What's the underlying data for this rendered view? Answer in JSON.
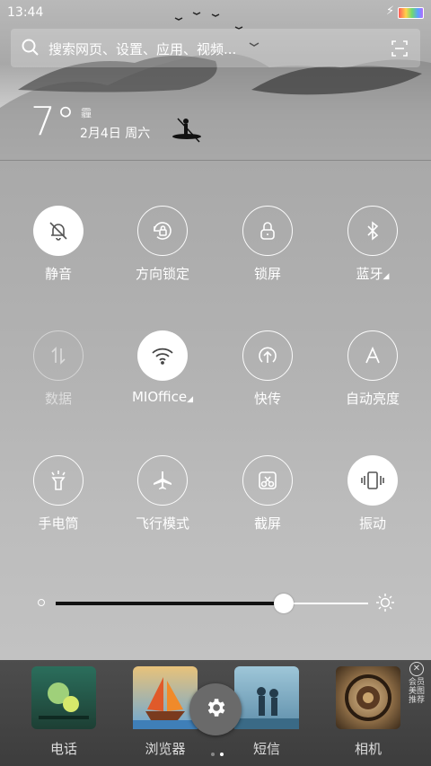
{
  "status_bar": {
    "time": "13:44",
    "charging_icon": "lightning-icon",
    "battery_icon": "battery-icon"
  },
  "search": {
    "placeholder": "搜索网页、设置、应用、视频...",
    "icon": "search-icon",
    "scan_icon": "scan-icon"
  },
  "weather": {
    "temperature": "7°",
    "condition": "霾",
    "date": "2月4日 周六"
  },
  "toggles": [
    {
      "label": "静音",
      "icon": "bell-off-icon",
      "state": "on"
    },
    {
      "label": "方向锁定",
      "icon": "rotation-lock-icon",
      "state": "off"
    },
    {
      "label": "锁屏",
      "icon": "lock-icon",
      "state": "off"
    },
    {
      "label": "蓝牙",
      "icon": "bluetooth-icon",
      "state": "off",
      "has_menu": true
    },
    {
      "label": "数据",
      "icon": "mobile-data-icon",
      "state": "disabled"
    },
    {
      "label": "MIOffice",
      "icon": "wifi-icon",
      "state": "on",
      "has_menu": true
    },
    {
      "label": "快传",
      "icon": "share-upload-icon",
      "state": "off"
    },
    {
      "label": "自动亮度",
      "icon": "auto-brightness-icon",
      "state": "off"
    },
    {
      "label": "手电筒",
      "icon": "flashlight-icon",
      "state": "off"
    },
    {
      "label": "飞行模式",
      "icon": "airplane-icon",
      "state": "off"
    },
    {
      "label": "截屏",
      "icon": "screenshot-icon",
      "state": "off"
    },
    {
      "label": "振动",
      "icon": "vibrate-icon",
      "state": "on"
    }
  ],
  "brightness": {
    "level": 0.73,
    "min_icon": "brightness-low-icon",
    "max_icon": "brightness-high-icon"
  },
  "dock": {
    "apps": [
      {
        "label": "电话",
        "icon": "phone-app-icon"
      },
      {
        "label": "浏览器",
        "icon": "browser-app-icon"
      },
      {
        "label": "短信",
        "icon": "messages-app-icon"
      },
      {
        "label": "相机",
        "icon": "camera-app-icon"
      }
    ],
    "settings_icon": "gear-icon",
    "ad_text": "会员美图推荐",
    "page_count": 2,
    "active_page": 2
  },
  "colors": {
    "toggle_on": "#ffffff",
    "shade_bg": "#b2b2b2",
    "dock_bg": "#444444"
  }
}
